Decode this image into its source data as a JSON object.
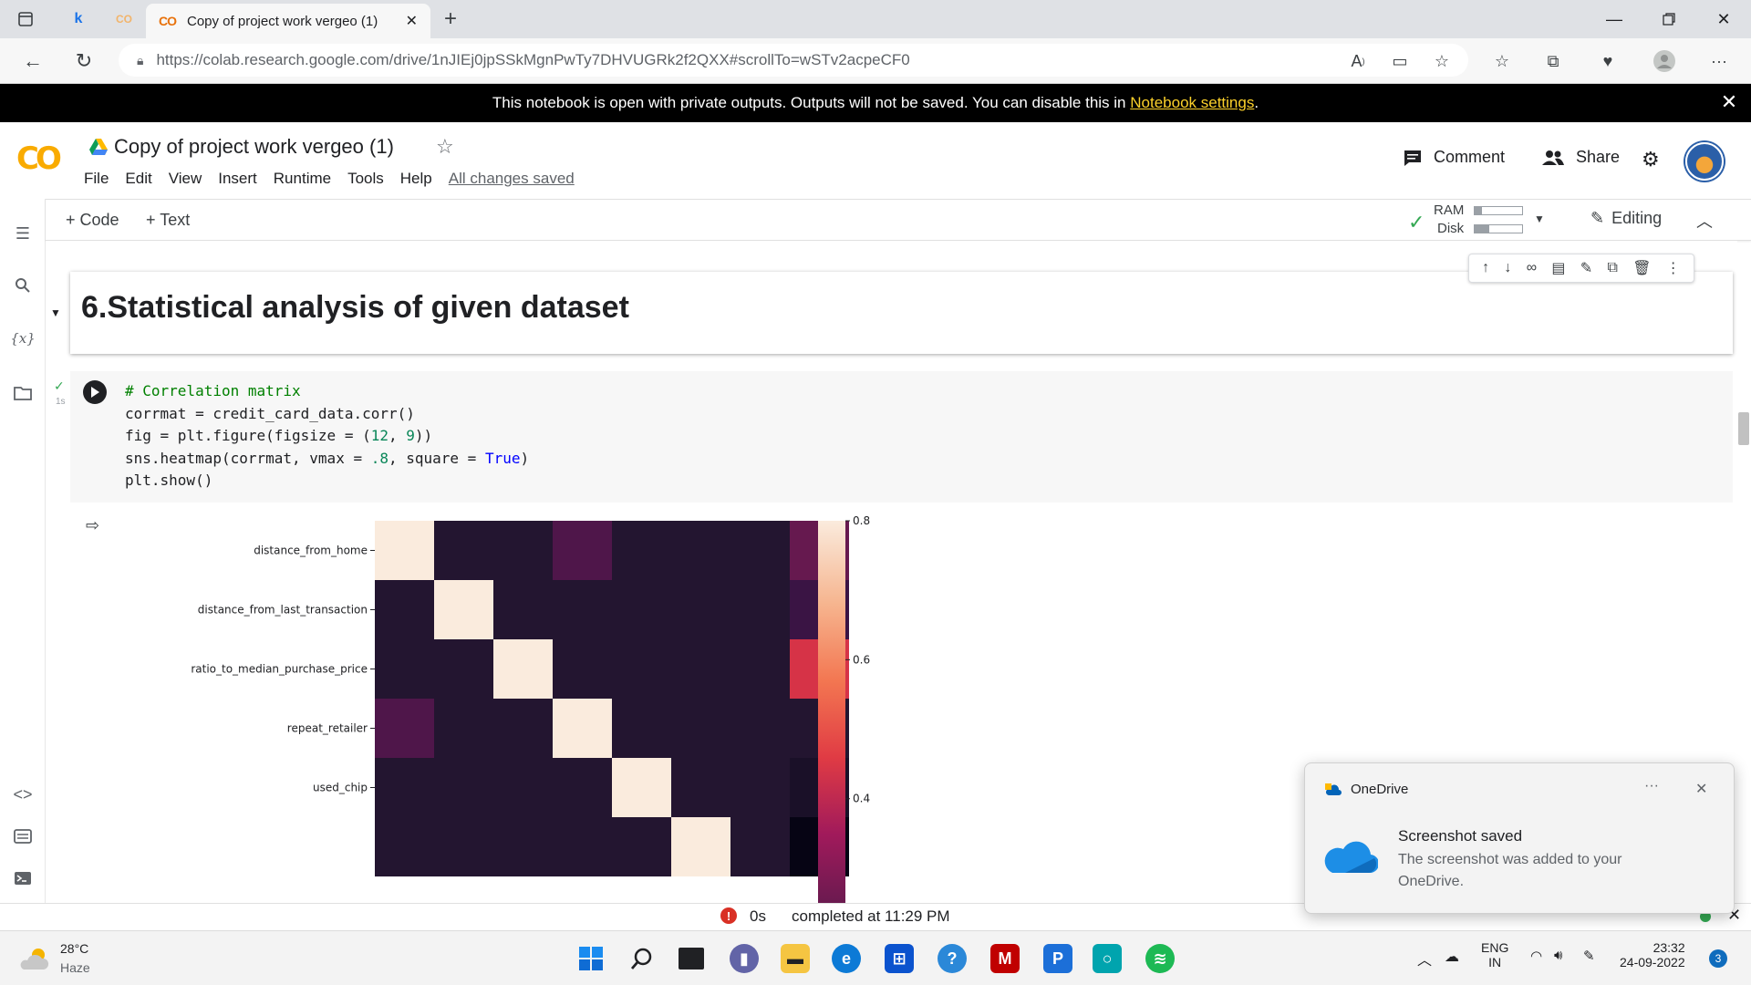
{
  "browser": {
    "tab_title": "Copy of project work vergeo (1)",
    "tab_logo": "CO",
    "pinned_tab_k": "k",
    "pinned_tab_co": "CO",
    "url": "https://colab.research.google.com/drive/1nJIEj0jpSSkMgnPwTy7DHVUGRk2f2QXX#scrollTo=wSTv2acpeCF0"
  },
  "notice": {
    "text": "This notebook is open with private outputs. Outputs will not be saved. You can disable this in ",
    "link": "Notebook settings",
    "suffix": "."
  },
  "colab": {
    "logo": "CO",
    "title": "Copy of project work vergeo (1)",
    "menu": [
      "File",
      "Edit",
      "View",
      "Insert",
      "Runtime",
      "Tools",
      "Help"
    ],
    "saved_status": "All changes saved",
    "comment_label": "Comment",
    "share_label": "Share"
  },
  "toolbar": {
    "code_label": "+ Code",
    "text_label": "+ Text",
    "ram_label": "RAM",
    "disk_label": "Disk",
    "ram_fraction": 0.15,
    "disk_fraction": 0.3,
    "editing_label": "Editing"
  },
  "cells": {
    "section_title": "6.Statistical analysis of given dataset",
    "exec_time": "1s",
    "code_lines": [
      "# Correlation matrix",
      "corrmat = credit_card_data.corr()",
      "fig = plt.figure(figsize = (12, 9))",
      "sns.heatmap(corrmat, vmax = .8, square = True)",
      "plt.show()"
    ]
  },
  "chart_data": {
    "type": "heatmap",
    "title": "",
    "rows": [
      "distance_from_home",
      "distance_from_last_transaction",
      "ratio_to_median_purchase_price",
      "repeat_retailer",
      "used_chip"
    ],
    "col_count": 8,
    "visible_values": [
      [
        1.0,
        0.0,
        0.0,
        0.14,
        0.0,
        0.0,
        0.0,
        0.19
      ],
      [
        0.0,
        1.0,
        0.0,
        0.0,
        0.0,
        0.0,
        0.0,
        0.09
      ],
      [
        0.0,
        0.0,
        1.0,
        0.0,
        0.0,
        0.0,
        0.0,
        0.46
      ],
      [
        0.14,
        0.0,
        0.0,
        1.0,
        0.0,
        0.0,
        0.0,
        0.0
      ],
      [
        0.0,
        0.0,
        0.0,
        0.0,
        1.0,
        0.0,
        0.0,
        -0.06
      ]
    ],
    "colorbar_ticks": [
      "0.8",
      "0.6",
      "0.4"
    ],
    "colorbar_tick_values": [
      0.8,
      0.6,
      0.4
    ],
    "vmax": 0.8,
    "vmin_visible": 0.25,
    "colormap": "rocket"
  },
  "status": {
    "duration": "0s",
    "completed": "completed at 11:29 PM"
  },
  "toast": {
    "app": "OneDrive",
    "title": "Screenshot saved",
    "body": "The screenshot was added to your OneDrive."
  },
  "taskbar": {
    "temperature": "28°C",
    "weather": "Haze",
    "lang_top": "ENG",
    "lang_bottom": "IN",
    "time": "23:32",
    "date": "24-09-2022",
    "notification_count": "3"
  },
  "colors": {
    "accent_colab": "#f9ab00",
    "notice_link": "#fcd12a",
    "heatmap_dark": "#231530",
    "heatmap_light": "#faebdd"
  }
}
